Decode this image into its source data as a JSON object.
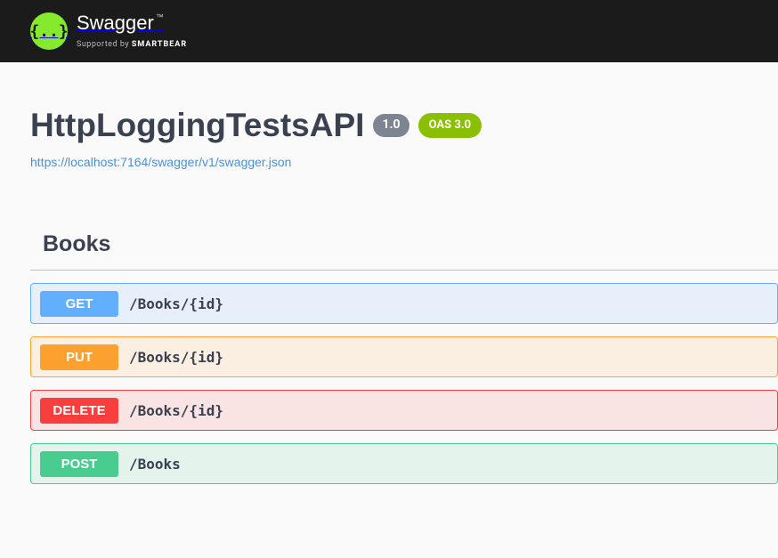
{
  "brand": {
    "logo_glyph": "{..}",
    "name": "Swagger",
    "tm": "™",
    "supported_prefix": "Supported by ",
    "supported_by": "SMARTBEAR"
  },
  "api": {
    "title": "HttpLoggingTestsAPI",
    "version": "1.0",
    "oas_badge": "OAS 3.0",
    "spec_url": "https://localhost:7164/swagger/v1/swagger.json"
  },
  "tag": {
    "name": "Books"
  },
  "operations": [
    {
      "method": "GET",
      "path": "/Books/{id}",
      "cls": "op-get"
    },
    {
      "method": "PUT",
      "path": "/Books/{id}",
      "cls": "op-put"
    },
    {
      "method": "DELETE",
      "path": "/Books/{id}",
      "cls": "op-delete"
    },
    {
      "method": "POST",
      "path": "/Books",
      "cls": "op-post"
    }
  ]
}
